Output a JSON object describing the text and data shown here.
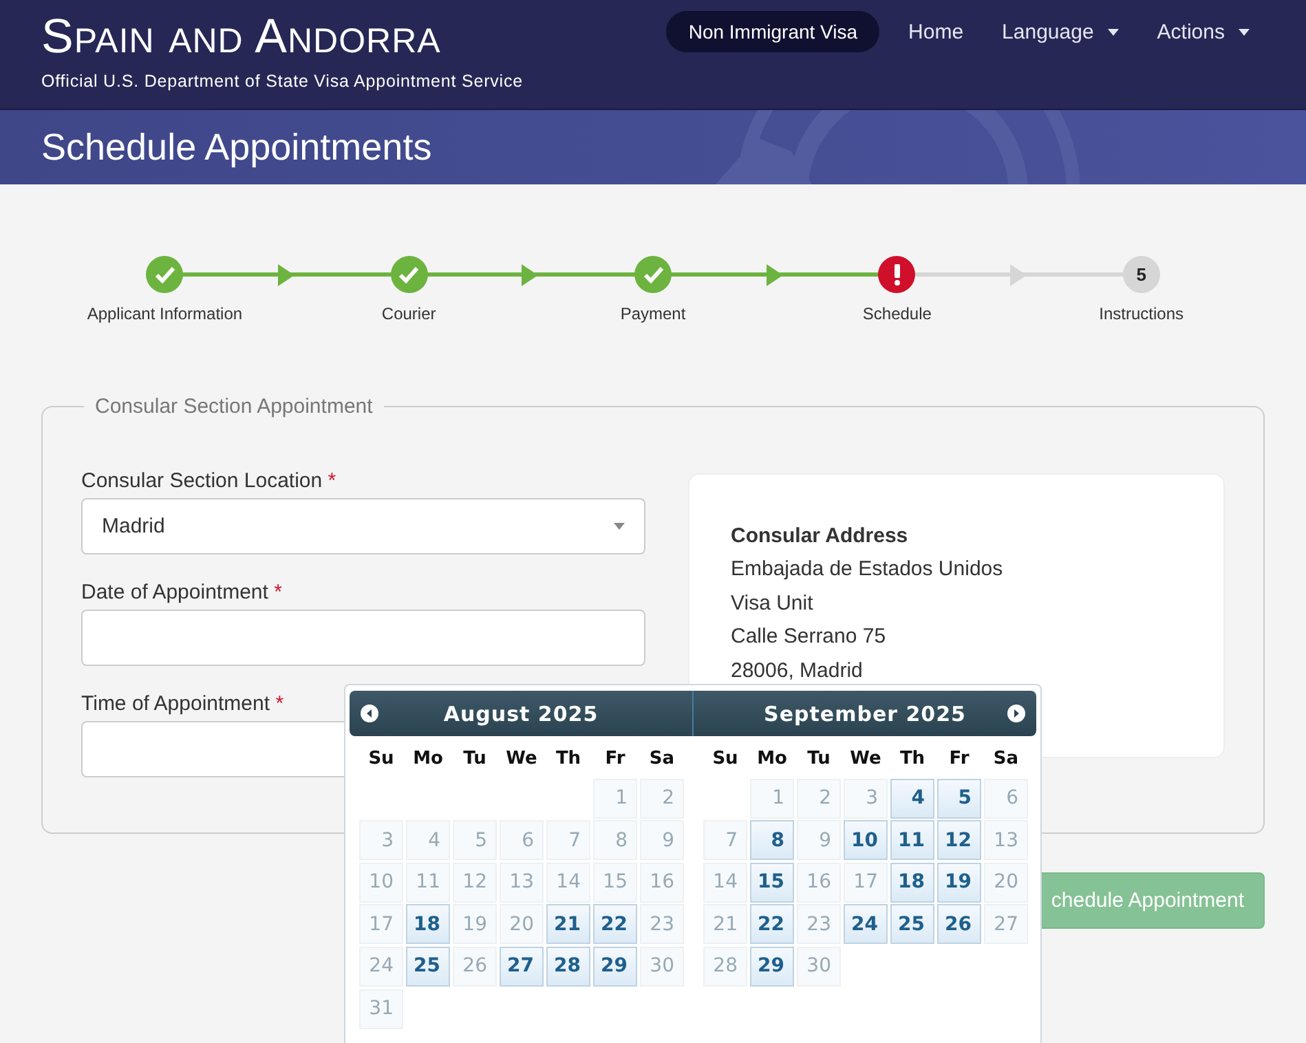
{
  "header": {
    "title": "Spain and Andorra",
    "subtitle": "Official U.S. Department of State Visa Appointment Service",
    "nav": [
      {
        "label": "Non Immigrant Visa",
        "kind": "pill",
        "dropdown": false
      },
      {
        "label": "Home",
        "kind": "link",
        "dropdown": false
      },
      {
        "label": "Language",
        "kind": "link",
        "dropdown": true
      },
      {
        "label": "Actions",
        "kind": "link",
        "dropdown": true
      }
    ]
  },
  "banner": {
    "title": "Schedule Appointments"
  },
  "steps": [
    {
      "label": "Applicant Information",
      "kind": "done"
    },
    {
      "label": "Courier",
      "kind": "done"
    },
    {
      "label": "Payment",
      "kind": "done"
    },
    {
      "label": "Schedule",
      "kind": "error"
    },
    {
      "label": "Instructions",
      "kind": "pending",
      "number": "5"
    }
  ],
  "form": {
    "legend": "Consular Section Appointment",
    "fields": [
      {
        "label": "Consular Section Location",
        "required_mark": "*",
        "kind": "select",
        "value": "Madrid"
      },
      {
        "label": "Date of Appointment",
        "required_mark": "*",
        "kind": "text"
      },
      {
        "label": "Time of Appointment",
        "required_mark": "*",
        "kind": "select"
      }
    ],
    "address": {
      "heading": "Consular Address",
      "lines": [
        "Embajada de Estados Unidos",
        "Visa Unit",
        "Calle Serrano 75",
        "28006, Madrid"
      ]
    },
    "submit_button": "chedule Appointment"
  },
  "datepicker": {
    "months": [
      {
        "title": "August 2025",
        "weekdays": [
          "Su",
          "Mo",
          "Tu",
          "We",
          "Th",
          "Fr",
          "Sa"
        ],
        "weeks": [
          [
            {
              "day": "1",
              "available": false
            },
            {
              "day": "2",
              "available": false
            }
          ],
          [
            {
              "day": "3",
              "available": false
            },
            {
              "day": "4",
              "available": false
            },
            {
              "day": "5",
              "available": false
            },
            {
              "day": "6",
              "available": false
            },
            {
              "day": "7",
              "available": false
            },
            {
              "day": "8",
              "available": false
            },
            {
              "day": "9",
              "available": false
            }
          ],
          [
            {
              "day": "10",
              "available": false
            },
            {
              "day": "11",
              "available": false
            },
            {
              "day": "12",
              "available": false
            },
            {
              "day": "13",
              "available": false
            },
            {
              "day": "14",
              "available": false
            },
            {
              "day": "15",
              "available": false
            },
            {
              "day": "16",
              "available": false
            }
          ],
          [
            {
              "day": "17",
              "available": false
            },
            {
              "day": "18",
              "available": true
            },
            {
              "day": "19",
              "available": false
            },
            {
              "day": "20",
              "available": false
            },
            {
              "day": "21",
              "available": true
            },
            {
              "day": "22",
              "available": true
            },
            {
              "day": "23",
              "available": false
            }
          ],
          [
            {
              "day": "24",
              "available": false
            },
            {
              "day": "25",
              "available": true
            },
            {
              "day": "26",
              "available": false
            },
            {
              "day": "27",
              "available": true
            },
            {
              "day": "28",
              "available": true
            },
            {
              "day": "29",
              "available": true
            },
            {
              "day": "30",
              "available": false
            }
          ],
          [
            {
              "day": "31",
              "available": false
            }
          ]
        ]
      },
      {
        "title": "September 2025",
        "weekdays": [
          "Su",
          "Mo",
          "Tu",
          "We",
          "Th",
          "Fr",
          "Sa"
        ],
        "weeks": [
          [
            {
              "day": "1",
              "available": false
            },
            {
              "day": "2",
              "available": false
            },
            {
              "day": "3",
              "available": false
            },
            {
              "day": "4",
              "available": true
            },
            {
              "day": "5",
              "available": true
            },
            {
              "day": "6",
              "available": false
            }
          ],
          [
            {
              "day": "7",
              "available": false
            },
            {
              "day": "8",
              "available": true
            },
            {
              "day": "9",
              "available": false
            },
            {
              "day": "10",
              "available": true
            },
            {
              "day": "11",
              "available": true
            },
            {
              "day": "12",
              "available": true
            },
            {
              "day": "13",
              "available": false
            }
          ],
          [
            {
              "day": "14",
              "available": false
            },
            {
              "day": "15",
              "available": true
            },
            {
              "day": "16",
              "available": false
            },
            {
              "day": "17",
              "available": false
            },
            {
              "day": "18",
              "available": true
            },
            {
              "day": "19",
              "available": true
            },
            {
              "day": "20",
              "available": false
            }
          ],
          [
            {
              "day": "21",
              "available": false
            },
            {
              "day": "22",
              "available": true
            },
            {
              "day": "23",
              "available": false
            },
            {
              "day": "24",
              "available": true
            },
            {
              "day": "25",
              "available": true
            },
            {
              "day": "26",
              "available": true
            },
            {
              "day": "27",
              "available": false
            }
          ],
          [
            {
              "day": "28",
              "available": false
            },
            {
              "day": "29",
              "available": true
            },
            {
              "day": "30",
              "available": false
            }
          ]
        ]
      }
    ]
  }
}
